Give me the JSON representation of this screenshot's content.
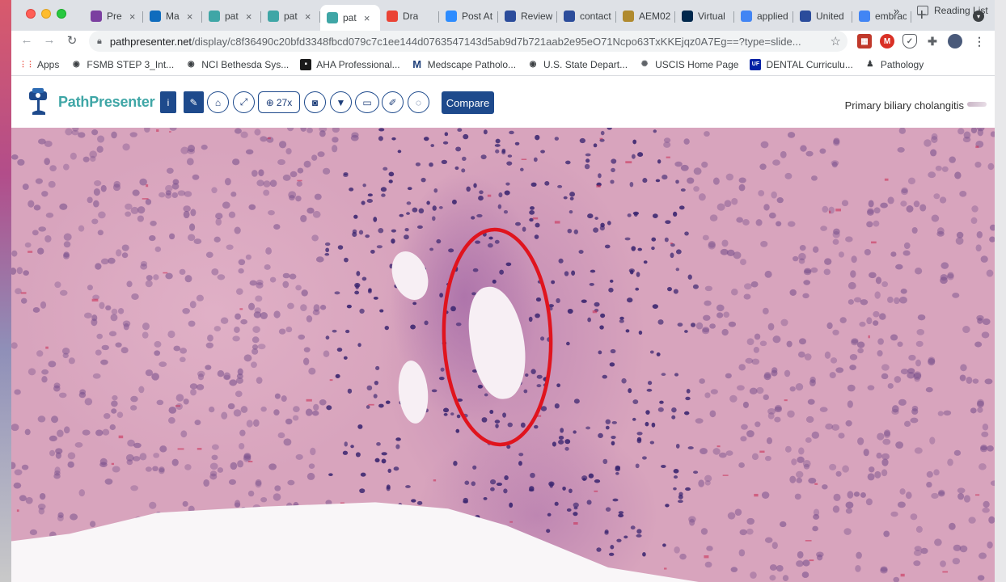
{
  "browser": {
    "tabs": [
      {
        "title": "Pre",
        "icon": "presentation-icon",
        "color": "#7b3fa0"
      },
      {
        "title": "Ma",
        "icon": "outlook-icon",
        "color": "#0f6cbd"
      },
      {
        "title": "pat",
        "icon": "pathpresenter-icon",
        "color": "#3fa6a6"
      },
      {
        "title": "pat",
        "icon": "pathpresenter-icon",
        "color": "#3fa6a6"
      },
      {
        "title": "pat",
        "icon": "pathpresenter-icon",
        "color": "#3fa6a6",
        "active": true
      },
      {
        "title": "Dra",
        "icon": "gmail-icon",
        "color": "#ea4335"
      },
      {
        "title": "Post At",
        "icon": "zoom-icon",
        "color": "#2d8cff"
      },
      {
        "title": "Review",
        "icon": "document-icon",
        "color": "#2b4c9b"
      },
      {
        "title": "contact",
        "icon": "document-icon",
        "color": "#2b4c9b"
      },
      {
        "title": "AEM02",
        "icon": "folder-icon",
        "color": "#b08a2e"
      },
      {
        "title": "Virtual",
        "icon": "michigan-icon",
        "color": "#00274c"
      },
      {
        "title": "applied",
        "icon": "google-icon",
        "color": "#4285f4"
      },
      {
        "title": "United",
        "icon": "document-icon",
        "color": "#2b4c9b"
      },
      {
        "title": "embrac",
        "icon": "google-icon",
        "color": "#4285f4"
      }
    ],
    "new_tab": "+",
    "url_host": "pathpresenter.net",
    "url_path": "/display/c8f36490c20bfd3348fbcd079c7c1ee144d0763547143d5ab9d7b721aab2e95eO71Ncpo63TxKKEjqz0A7Eg==?type=slide...",
    "bookmarks": [
      {
        "label": "Apps",
        "icon": "apps-grid-icon"
      },
      {
        "label": "FSMB STEP 3_Int...",
        "icon": "globe-icon"
      },
      {
        "label": "NCI Bethesda Sys...",
        "icon": "globe-icon"
      },
      {
        "label": "AHA Professional...",
        "icon": "aha-icon"
      },
      {
        "label": "Medscape Patholo...",
        "icon": "medscape-icon"
      },
      {
        "label": "U.S. State Depart...",
        "icon": "globe-icon"
      },
      {
        "label": "USCIS Home Page",
        "icon": "seal-icon"
      },
      {
        "label": "DENTAL Curriculu...",
        "icon": "uf-icon"
      },
      {
        "label": "Pathology",
        "icon": "person-icon"
      }
    ],
    "bookmarks_more": "»",
    "reading_list": "Reading List"
  },
  "app": {
    "logo_text": "PathPresenter",
    "zoom_label": "27x",
    "compare_label": "Compare",
    "slide_title": "Primary biliary cholangitis"
  },
  "colors": {
    "brand_teal": "#3fa6a6",
    "toolbar_blue": "#1e4a8c",
    "annotation_red": "#e0141e"
  }
}
